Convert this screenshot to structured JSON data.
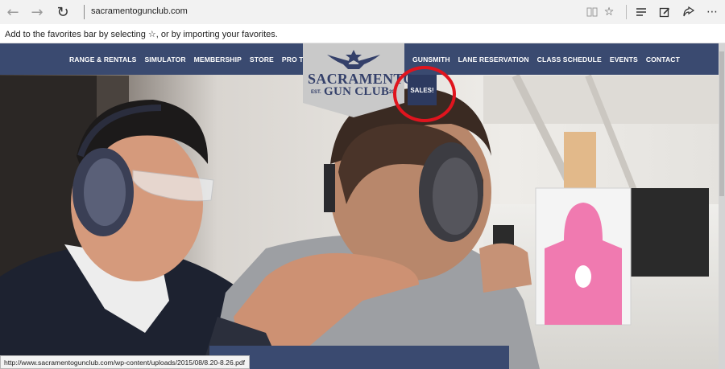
{
  "browser": {
    "url": "sacramentogunclub.com",
    "icons": {
      "back": "back-arrow-icon",
      "forward": "forward-arrow-icon",
      "refresh": "refresh-icon",
      "reading_view": "reading-view-icon",
      "favorite": "star-icon",
      "hub": "hub-icon",
      "web_note": "web-note-icon",
      "share": "share-icon",
      "more": "more-icon"
    },
    "favorites_hint": "Add to the favorites bar by selecting ☆, or by importing your favorites.",
    "status_url": "http://www.sacramentogunclub.com/wp-content/uploads/2015/08/8.20-8.26.pdf"
  },
  "site": {
    "nav_left": [
      "RANGE & RENTALS",
      "SIMULATOR",
      "MEMBERSHIP",
      "STORE",
      "PRO TRAINING"
    ],
    "nav_right": [
      "GUNSMITH",
      "LANE RESERVATION",
      "CLASS SCHEDULE",
      "EVENTS",
      "CONTACT"
    ],
    "logo": {
      "line1": "SACRAMENTO",
      "line2": "GUN CLUB",
      "est": "EST.",
      "year": "20"
    },
    "sales_label": "SALES!",
    "colors": {
      "nav": "#3a4a70",
      "sales": "#2d3a60",
      "annotation": "#e0141e",
      "target": "#f07ab0"
    }
  }
}
